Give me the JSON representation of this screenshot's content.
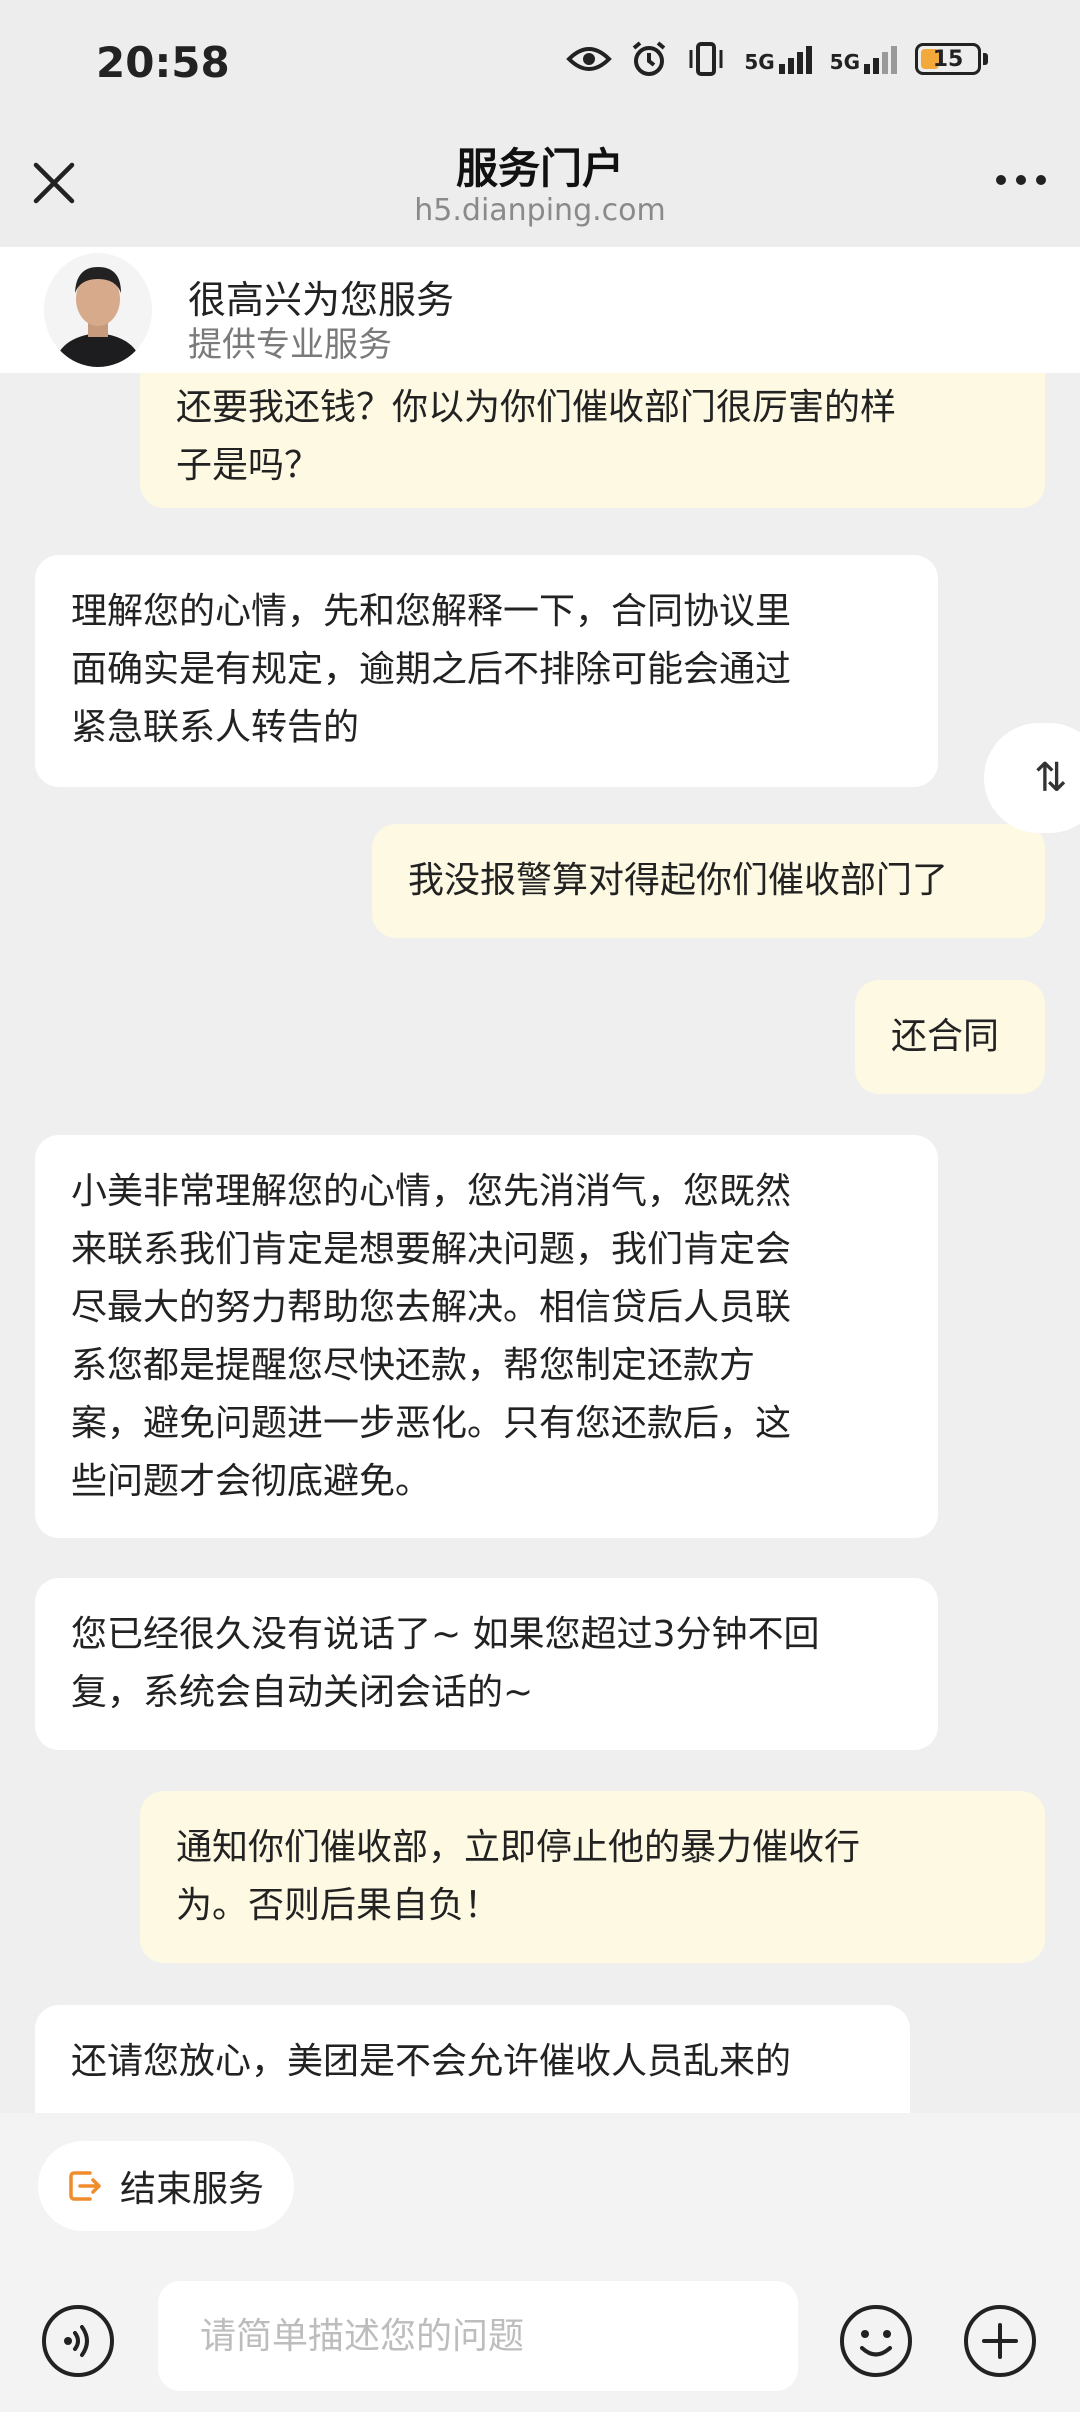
{
  "status_bar": {
    "time": "20:58",
    "signal_label_1": "5G",
    "signal_label_2": "5G",
    "battery": "15"
  },
  "nav": {
    "title": "服务门户",
    "url": "h5.dianping.com"
  },
  "agent": {
    "name": "很高兴为您服务",
    "description": "提供专业服务"
  },
  "messages": [
    {
      "role": "user",
      "lines": [
        "还要我还钱？你以为你们催收部门很厉害的样",
        "子是吗？"
      ]
    },
    {
      "role": "agent",
      "lines": [
        "理解您的心情，先和您解释一下，合同协议里",
        "面确实是有规定，逾期之后不排除可能会通过",
        "紧急联系人转告的"
      ]
    },
    {
      "role": "user",
      "lines": [
        "我没报警算对得起你们催收部门了"
      ]
    },
    {
      "role": "user",
      "lines": [
        "还合同"
      ]
    },
    {
      "role": "agent",
      "lines": [
        "小美非常理解您的心情，您先消消气，您既然",
        "来联系我们肯定是想要解决问题，我们肯定会",
        "尽最大的努力帮助您去解决。相信贷后人员联",
        "系您都是提醒您尽快还款，帮您制定还款方",
        "案，避免问题进一步恶化。只有您还款后，这",
        "些问题才会彻底避免。"
      ]
    },
    {
      "role": "agent",
      "lines": [
        "您已经很久没有说话了~ 如果您超过3分钟不回",
        "复，系统会自动关闭会话的~"
      ]
    },
    {
      "role": "user",
      "lines": [
        "通知你们催收部，立即停止他的暴力催收行",
        "为。否则后果自负！"
      ]
    },
    {
      "role": "agent",
      "lines": [
        "还请您放心，美团是不会允许催收人员乱来的"
      ]
    }
  ],
  "scroll_toggle_icon": "⇅",
  "bottom": {
    "end_service_label": "结束服务",
    "input_placeholder": "请简单描述您的问题"
  },
  "colors": {
    "user_bubble": "#fdf9e3",
    "agent_bubble": "#ffffff",
    "end_icon": "#f08c2b",
    "background": "#efefef"
  }
}
